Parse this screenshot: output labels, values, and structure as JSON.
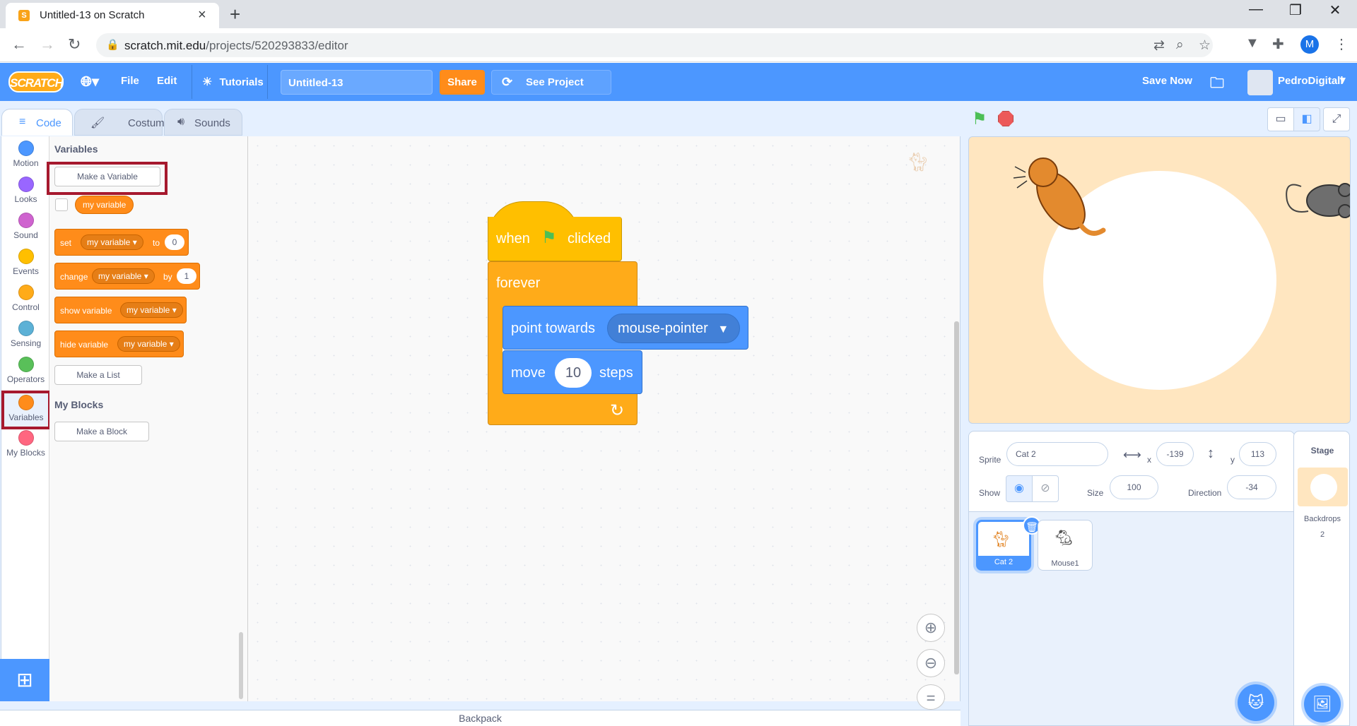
{
  "browser": {
    "tab_title": "Untitled-13 on Scratch",
    "favicon": "S",
    "new_tab": "+",
    "url_host": "scratch.mit.edu",
    "url_path": "/projects/520293833/editor",
    "profile_initial": "M"
  },
  "menu": {
    "logo": "SCRATCH",
    "file": "File",
    "edit": "Edit",
    "tutorials": "Tutorials",
    "project_title": "Untitled-13",
    "share": "Share",
    "see_project": "See Project Page",
    "save_now": "Save Now",
    "username": "PedroDigitall"
  },
  "tabs": {
    "code": "Code",
    "costumes": "Costumes",
    "sounds": "Sounds"
  },
  "categories": [
    {
      "label": "Motion",
      "color": "#4c97ff"
    },
    {
      "label": "Looks",
      "color": "#9966ff"
    },
    {
      "label": "Sound",
      "color": "#cf63cf"
    },
    {
      "label": "Events",
      "color": "#ffbf00"
    },
    {
      "label": "Control",
      "color": "#ffab19"
    },
    {
      "label": "Sensing",
      "color": "#5cb1d6"
    },
    {
      "label": "Operators",
      "color": "#59c059"
    },
    {
      "label": "Variables",
      "color": "#ff8c1a"
    },
    {
      "label": "My Blocks",
      "color": "#ff6680"
    }
  ],
  "flyout": {
    "variables_heading": "Variables",
    "make_variable": "Make a Variable",
    "my_variable": "my variable",
    "set_block": {
      "keyword": "set",
      "var": "my variable",
      "to": "to",
      "value": "0"
    },
    "change_block": {
      "keyword": "change",
      "var": "my variable",
      "by": "by",
      "value": "1"
    },
    "show_block": {
      "keyword": "show variable",
      "var": "my variable"
    },
    "hide_block": {
      "keyword": "hide variable",
      "var": "my variable"
    },
    "make_list": "Make a List",
    "myblocks_heading": "My Blocks",
    "make_block": "Make a Block"
  },
  "script": {
    "when": "when",
    "clicked": "clicked",
    "forever": "forever",
    "point_towards": "point towards",
    "target": "mouse-pointer",
    "move": "move",
    "steps_value": "10",
    "steps": "steps"
  },
  "backpack": "Backpack",
  "sprite_info": {
    "sprite_label": "Sprite",
    "sprite_name": "Cat 2",
    "x_label": "x",
    "x": "-139",
    "y_label": "y",
    "y": "113",
    "show_label": "Show",
    "size_label": "Size",
    "size": "100",
    "direction_label": "Direction",
    "direction": "-34"
  },
  "sprites": [
    {
      "name": "Cat 2",
      "selected": true
    },
    {
      "name": "Mouse1",
      "selected": false
    }
  ],
  "stage_panel": {
    "label": "Stage",
    "backdrops_label": "Backdrops",
    "backdrops_count": "2"
  },
  "colors": {
    "scratch_blue": "#4c97ff",
    "variables_orange": "#ff8c1a",
    "events_yellow": "#ffbf00",
    "control_orange": "#ffab19",
    "highlight_red": "#a6192e"
  }
}
